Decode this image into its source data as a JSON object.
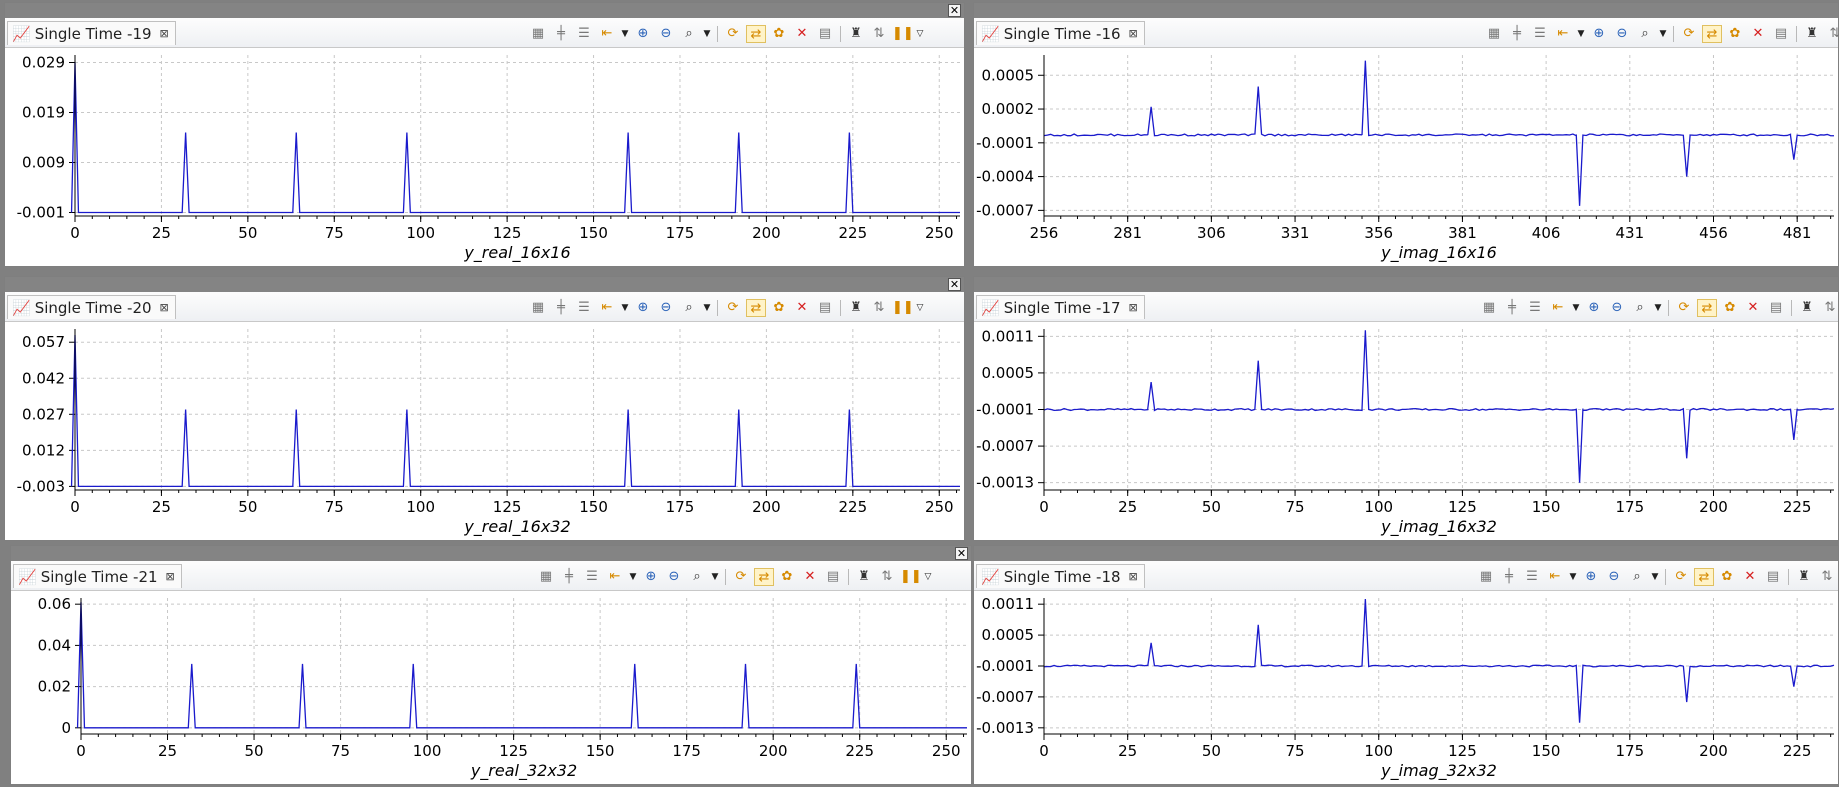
{
  "ui": {
    "close_glyph": "✕",
    "tab_close_glyph": "⊠",
    "series_color": "#1a1acc"
  },
  "panels": [
    {
      "tab_title": "Single Time -19",
      "chart_data": {
        "type": "line",
        "xlabel": "y_real_16x16",
        "xlim": [
          0,
          256
        ],
        "ylim": [
          -0.0017,
          0.0305
        ],
        "xticks": [
          "0",
          "25",
          "50",
          "75",
          "100",
          "125",
          "150",
          "175",
          "200",
          "225",
          "250"
        ],
        "yticks": [
          "0.029",
          "0.019",
          "0.009",
          "-0.001"
        ],
        "ytick_values": [
          0.029,
          0.019,
          0.009,
          -0.001
        ],
        "baseline": -0.001,
        "spikes": [
          {
            "x": 0,
            "y": 0.029
          },
          {
            "x": 32,
            "y": 0.015
          },
          {
            "x": 64,
            "y": 0.015
          },
          {
            "x": 96,
            "y": 0.015
          },
          {
            "x": 160,
            "y": 0.015
          },
          {
            "x": 192,
            "y": 0.015
          },
          {
            "x": 224,
            "y": 0.015
          }
        ]
      }
    },
    {
      "tab_title": "Single Time -20",
      "chart_data": {
        "type": "line",
        "xlabel": "y_real_16x32",
        "xlim": [
          0,
          256
        ],
        "ylim": [
          -0.0045,
          0.0625
        ],
        "xticks": [
          "0",
          "25",
          "50",
          "75",
          "100",
          "125",
          "150",
          "175",
          "200",
          "225",
          "250"
        ],
        "yticks": [
          "0.057",
          "0.042",
          "0.027",
          "0.012",
          "-0.003"
        ],
        "ytick_values": [
          0.057,
          0.042,
          0.027,
          0.012,
          -0.003
        ],
        "baseline": -0.003,
        "spikes": [
          {
            "x": 0,
            "y": 0.06
          },
          {
            "x": 32,
            "y": 0.029
          },
          {
            "x": 64,
            "y": 0.029
          },
          {
            "x": 96,
            "y": 0.029
          },
          {
            "x": 160,
            "y": 0.029
          },
          {
            "x": 192,
            "y": 0.029
          },
          {
            "x": 224,
            "y": 0.029
          }
        ]
      }
    },
    {
      "tab_title": "Single Time -21",
      "chart_data": {
        "type": "line",
        "xlabel": "y_real_32x32",
        "xlim": [
          0,
          256
        ],
        "ylim": [
          -0.003,
          0.063
        ],
        "xticks": [
          "0",
          "25",
          "50",
          "75",
          "100",
          "125",
          "150",
          "175",
          "200",
          "225",
          "250"
        ],
        "yticks": [
          "0.06",
          "0.04",
          "0.02",
          "0"
        ],
        "ytick_values": [
          0.06,
          0.04,
          0.02,
          0
        ],
        "baseline": 0,
        "spikes": [
          {
            "x": 0,
            "y": 0.061
          },
          {
            "x": 32,
            "y": 0.031
          },
          {
            "x": 64,
            "y": 0.031
          },
          {
            "x": 96,
            "y": 0.031
          },
          {
            "x": 160,
            "y": 0.031
          },
          {
            "x": 192,
            "y": 0.031
          },
          {
            "x": 224,
            "y": 0.031
          }
        ]
      }
    },
    {
      "tab_title": "Single Time -16",
      "chart_data": {
        "type": "line",
        "xlabel": "y_imag_16x16",
        "xlim": [
          256,
          492
        ],
        "ylim": [
          -0.00075,
          0.00068
        ],
        "xticks": [
          "256",
          "281",
          "306",
          "331",
          "356",
          "381",
          "406",
          "431",
          "456",
          "481"
        ],
        "yticks": [
          "0.0005",
          "0.0002",
          "-0.0001",
          "-0.0004",
          "-0.0007"
        ],
        "ytick_values": [
          0.0005,
          0.0002,
          -0.0001,
          -0.0004,
          -0.0007
        ],
        "baseline": -3e-05,
        "spikes": [
          {
            "x": 288,
            "y": 0.00022
          },
          {
            "x": 320,
            "y": 0.0004
          },
          {
            "x": 352,
            "y": 0.00063
          },
          {
            "x": 416,
            "y": -0.00066
          },
          {
            "x": 448,
            "y": -0.0004
          },
          {
            "x": 480,
            "y": -0.00025
          }
        ]
      }
    },
    {
      "tab_title": "Single Time -17",
      "chart_data": {
        "type": "line",
        "xlabel": "y_imag_16x32",
        "xlim": [
          0,
          236
        ],
        "ylim": [
          -0.00142,
          0.00122
        ],
        "xticks": [
          "0",
          "25",
          "50",
          "75",
          "100",
          "125",
          "150",
          "175",
          "200",
          "225"
        ],
        "yticks": [
          "0.0011",
          "0.0005",
          "-0.0001",
          "-0.0007",
          "-0.0013"
        ],
        "ytick_values": [
          0.0011,
          0.0005,
          -0.0001,
          -0.0007,
          -0.0013
        ],
        "baseline": -0.0001,
        "spikes": [
          {
            "x": 32,
            "y": 0.00035
          },
          {
            "x": 64,
            "y": 0.0007
          },
          {
            "x": 96,
            "y": 0.0012
          },
          {
            "x": 160,
            "y": -0.0013
          },
          {
            "x": 192,
            "y": -0.0009
          },
          {
            "x": 224,
            "y": -0.0006
          }
        ]
      }
    },
    {
      "tab_title": "Single Time -18",
      "chart_data": {
        "type": "line",
        "xlabel": "y_imag_32x32",
        "xlim": [
          0,
          236
        ],
        "ylim": [
          -0.00142,
          0.00122
        ],
        "xticks": [
          "0",
          "25",
          "50",
          "75",
          "100",
          "125",
          "150",
          "175",
          "200",
          "225"
        ],
        "yticks": [
          "0.0011",
          "0.0005",
          "-0.0001",
          "-0.0007",
          "-0.0013"
        ],
        "ytick_values": [
          0.0011,
          0.0005,
          -0.0001,
          -0.0007,
          -0.0013
        ],
        "baseline": -0.0001,
        "spikes": [
          {
            "x": 32,
            "y": 0.00035
          },
          {
            "x": 64,
            "y": 0.0007
          },
          {
            "x": 96,
            "y": 0.0012
          },
          {
            "x": 160,
            "y": -0.0012
          },
          {
            "x": 192,
            "y": -0.0008
          },
          {
            "x": 224,
            "y": -0.0005
          }
        ]
      }
    }
  ]
}
